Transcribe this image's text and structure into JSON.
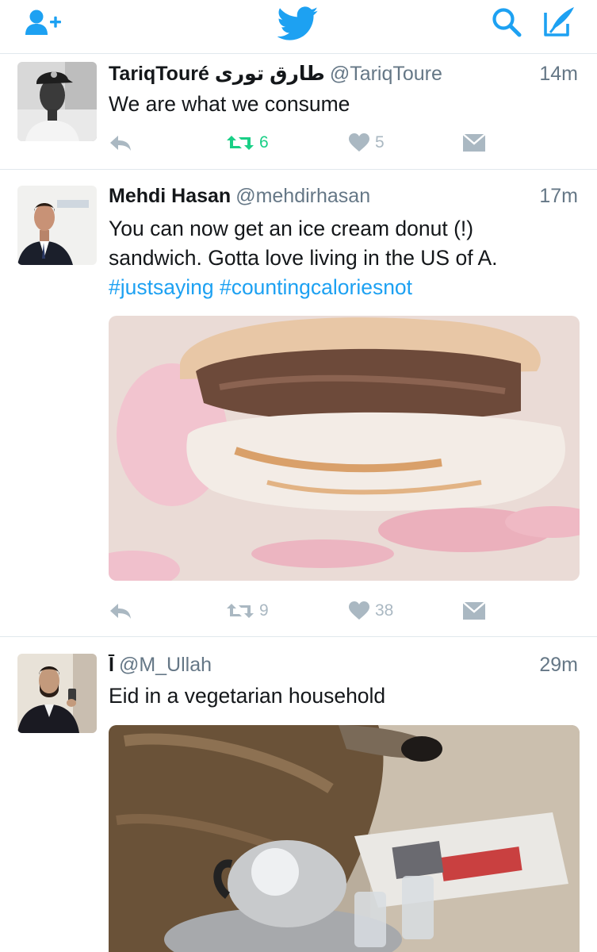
{
  "nav": {
    "left_icon": "add-user-icon",
    "center_icon": "twitter-bird-icon",
    "right_icons": [
      "search-icon",
      "compose-tweet-icon"
    ],
    "accent_color": "#1da1f2"
  },
  "tweets": [
    {
      "name": "TariqTouré طارق تورى",
      "handle": "@TariqToure",
      "time": "14m",
      "text": "We are what we consume",
      "actions": {
        "reply": "",
        "retweets": "6",
        "retweeted": true,
        "likes": "5"
      }
    },
    {
      "name": "Mehdi Hasan",
      "handle": "@mehdirhasan",
      "time": "17m",
      "text_line1": "You can now get an ice cream donut (!)",
      "text_line2": "sandwich. Gotta love living in the US of A.",
      "hashtag1": "#justsaying",
      "hashtag2": "#countingcaloriesnot",
      "media": "ice-cream-donut-sandwich-photo",
      "actions": {
        "reply": "",
        "retweets": "9",
        "retweeted": false,
        "likes": "38"
      }
    },
    {
      "name": "Ī",
      "handle": "@M_Ullah",
      "time": "29m",
      "text": "Eid in a vegetarian household",
      "media": "sheep-with-teapot-and-newspaper-photo"
    }
  ],
  "colors": {
    "retweet_active": "#19cf86",
    "action_gray": "#aab8c2",
    "meta_gray": "#657786",
    "divider": "#e1e8ed"
  }
}
